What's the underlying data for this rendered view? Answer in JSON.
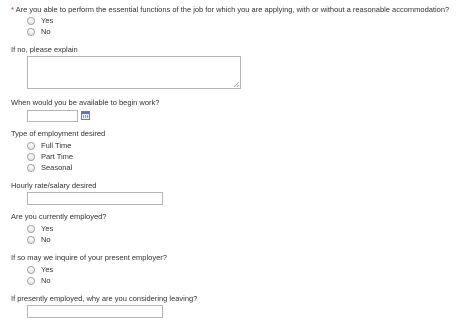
{
  "form": {
    "q_accommodation": {
      "required_mark": "*",
      "label": "Are you able to perform the essential functions of the job for which you are applying, with or without a reasonable accommodation?",
      "options": [
        "Yes",
        "No"
      ]
    },
    "q_explain": {
      "label": "If no, please explain",
      "value": ""
    },
    "q_start": {
      "label": "When would you be available to begin work?",
      "value": "",
      "icon": "calendar-icon"
    },
    "q_employment_type": {
      "label": "Type of employment desired",
      "options": [
        "Full Time",
        "Part Time",
        "Seasonal"
      ]
    },
    "q_salary": {
      "label": "Hourly rate/salary desired",
      "value": ""
    },
    "q_currently_employed": {
      "label": "Are you currently employed?",
      "options": [
        "Yes",
        "No"
      ]
    },
    "q_inquire": {
      "label": "If so may we inquire of your present employer?",
      "options": [
        "Yes",
        "No"
      ]
    },
    "q_leaving": {
      "label": "If presently employed, why are you considering leaving?",
      "value": ""
    }
  }
}
